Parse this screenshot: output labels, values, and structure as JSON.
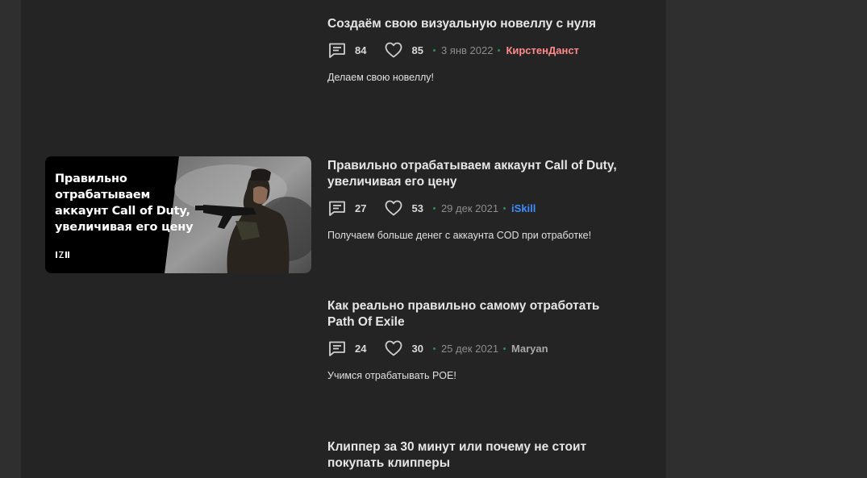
{
  "articles": [
    {
      "title": "Создаём свою визуальную новеллу с нуля",
      "comments": "84",
      "likes": "85",
      "date": "3 янв 2022",
      "author": "КирстенДанст",
      "author_color": "#ff8a8a",
      "description": "Делаем свою новеллу!"
    },
    {
      "title": "Правильно отрабатываем аккаунт Call of Duty, увеличивая его цену",
      "comments": "27",
      "likes": "53",
      "date": "29 дек 2021",
      "author": "iSkill",
      "author_color": "#3d8cff",
      "description": "Получаем больше денег с аккаунта COD при отработке!",
      "thumbnail": {
        "text": "Правильно\nотрабатываем\nаккаунт Call of Duty,\nувеличивая его цену",
        "logo": "IZI",
        "image": "soldier-with-rifle"
      }
    },
    {
      "title": "Как реально правильно самому отработать Path Of Exile",
      "comments": "24",
      "likes": "30",
      "date": "25 дек 2021",
      "author": "Maryan",
      "author_color": "#a8a8a8",
      "description": "Учимся отрабатывать POE!"
    },
    {
      "title": "Клиппер за 30 минут или почему не стоит покупать клипперы"
    }
  ],
  "icons": {
    "comments": "comment-icon",
    "likes": "heart-icon"
  },
  "colors": {
    "page_background": "#2f2f2f",
    "content_background": "#242424",
    "separator_dot": "#2e8b57"
  }
}
